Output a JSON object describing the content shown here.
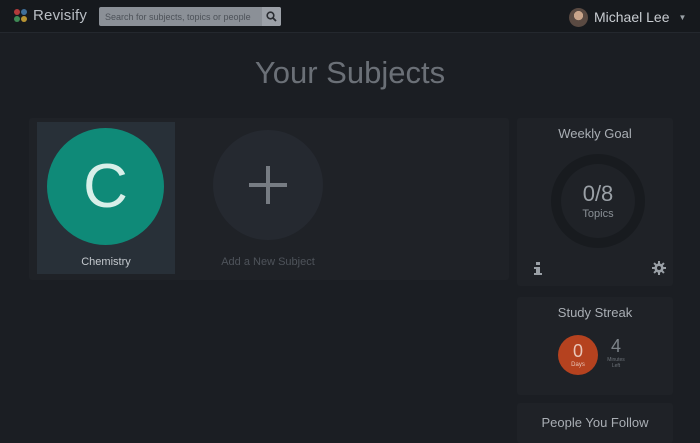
{
  "app": {
    "brand_name": "Revisify",
    "logo_colors": [
      "#b33b3b",
      "#3f6f9a",
      "#3e8a55",
      "#b89433"
    ]
  },
  "search": {
    "placeholder": "Search for subjects, topics or people",
    "icon": "search-icon"
  },
  "user": {
    "name": "Michael Lee",
    "menu_icon": "caret-down-icon"
  },
  "page": {
    "title": "Your Subjects"
  },
  "subjects": [
    {
      "letter": "C",
      "name": "Chemistry",
      "color": "#0f8a78"
    }
  ],
  "add_subject": {
    "label": "Add a New Subject",
    "icon": "plus-icon"
  },
  "weekly_goal": {
    "title": "Weekly Goal",
    "count": "0/8",
    "unit": "Topics",
    "info_icon": "info-icon",
    "settings_icon": "gear-icon"
  },
  "study_streak": {
    "title": "Study Streak",
    "days_value": "0",
    "days_label": "Days",
    "minutes_value": "4",
    "minutes_label": "Minutes Left",
    "accent": "#b5421f"
  },
  "people_you_follow": {
    "title": "People You Follow"
  }
}
